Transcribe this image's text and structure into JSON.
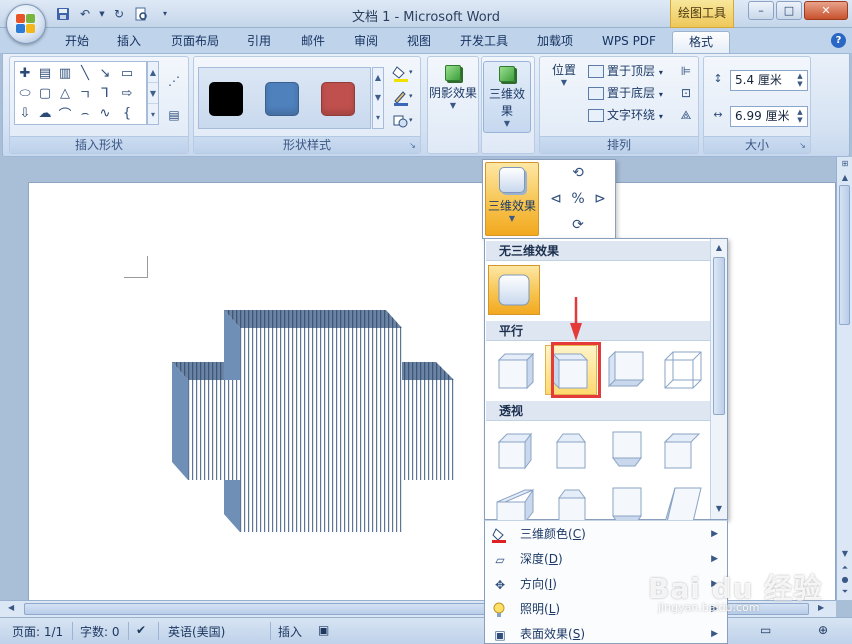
{
  "window": {
    "title": "文档 1 - Microsoft Word",
    "context_tab_group": "绘图工具",
    "controls": {
      "minimize": "–",
      "maximize": "□",
      "close": "✕"
    }
  },
  "quick_access": {
    "items": [
      "save-icon",
      "undo-icon",
      "redo-icon",
      "print-preview-icon",
      "customize-qat-icon"
    ]
  },
  "tabs": [
    {
      "label": "开始",
      "active": false
    },
    {
      "label": "插入",
      "active": false
    },
    {
      "label": "页面布局",
      "active": false
    },
    {
      "label": "引用",
      "active": false
    },
    {
      "label": "邮件",
      "active": false
    },
    {
      "label": "审阅",
      "active": false
    },
    {
      "label": "视图",
      "active": false
    },
    {
      "label": "开发工具",
      "active": false
    },
    {
      "label": "加载项",
      "active": false
    },
    {
      "label": "WPS PDF",
      "active": false
    },
    {
      "label": "格式",
      "active": true
    }
  ],
  "help_label": "?",
  "ribbon": {
    "insert_shapes": {
      "label": "插入形状"
    },
    "shape_styles": {
      "label": "形状样式",
      "swatches": [
        "#000000",
        "#4f81bd",
        "#c0504d"
      ]
    },
    "shadow_effects": {
      "label": "阴影效果"
    },
    "three_d_effects": {
      "label": "三维效果"
    },
    "arrange": {
      "label": "排列",
      "position": "位置",
      "bring_to_front": "置于顶层",
      "send_to_back": "置于底层",
      "text_wrap": "文字环绕"
    },
    "size": {
      "label": "大小",
      "height": "5.4 厘米",
      "width": "6.99 厘米"
    }
  },
  "flyout": {
    "button_label": "三维效果",
    "sections": {
      "none": "无三维效果",
      "parallel": "平行",
      "perspective": "透视"
    },
    "menu": [
      {
        "label": "三维颜色",
        "key": "C",
        "icon": "fill-color-icon"
      },
      {
        "label": "深度",
        "key": "D",
        "icon": "depth-icon"
      },
      {
        "label": "方向",
        "key": "I",
        "icon": "direction-icon"
      },
      {
        "label": "照明",
        "key": "L",
        "icon": "lighting-icon"
      },
      {
        "label": "表面效果",
        "key": "S",
        "icon": "surface-icon"
      }
    ]
  },
  "status": {
    "page": "页面: 1/1",
    "words": "字数: 0",
    "language": "英语(美国)",
    "mode": "插入"
  },
  "watermark": {
    "brand": "Bai du 经验",
    "url": "jingyan.baidu.com"
  }
}
